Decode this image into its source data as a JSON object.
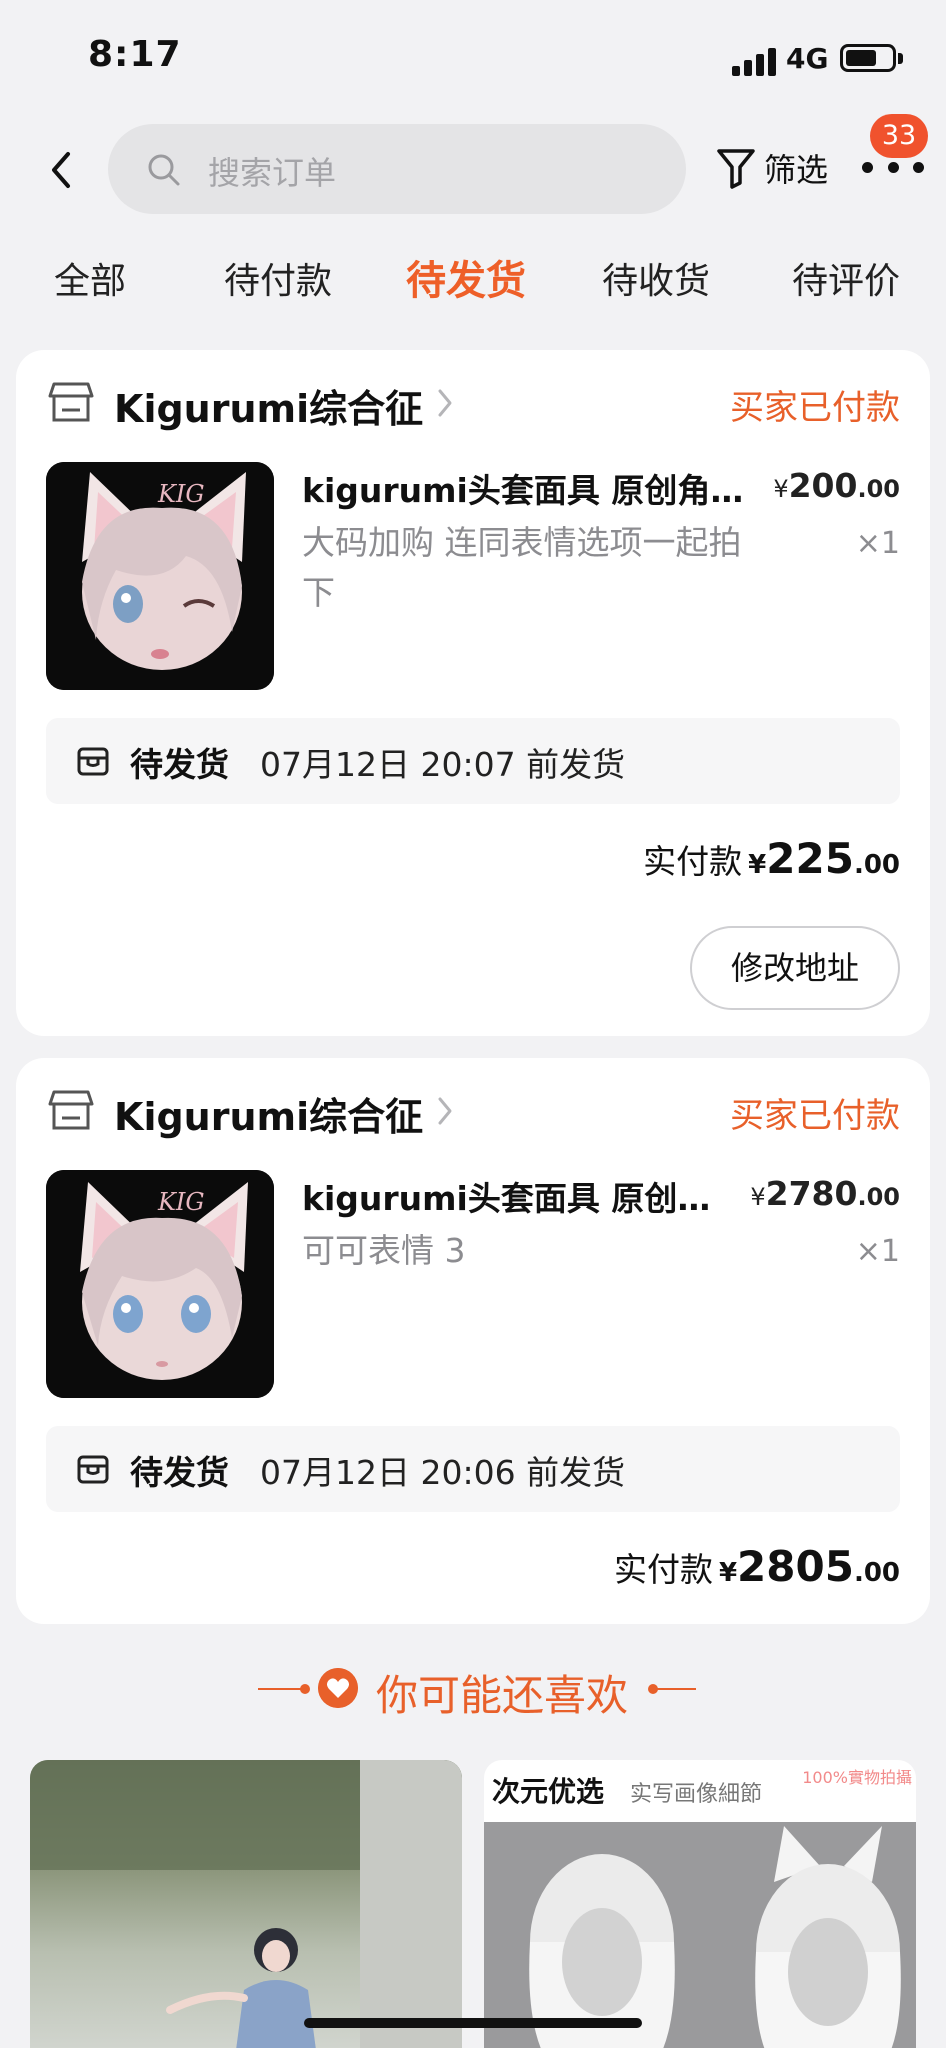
{
  "status_bar": {
    "time": "8:17",
    "network": "4G"
  },
  "search": {
    "placeholder": "搜索订单"
  },
  "header": {
    "filter_label": "筛选",
    "message_badge": "33"
  },
  "tabs": [
    {
      "label": "全部",
      "active": false
    },
    {
      "label": "待付款",
      "active": false
    },
    {
      "label": "待发货",
      "active": true
    },
    {
      "label": "待收货",
      "active": false
    },
    {
      "label": "待评价",
      "active": false
    }
  ],
  "orders": [
    {
      "store_name": "Kigurumi综合征",
      "status": "买家已付款",
      "product_title": "kigurumi头套面具 原创角…",
      "product_spec": "大码加购 连同表情选项一起拍下",
      "price_symbol": "¥",
      "price_int": "200",
      "price_dec": ".00",
      "quantity": "×1",
      "ship_label": "待发货",
      "ship_deadline": "07月12日 20:07 前发货",
      "total_label": "实付款",
      "total_symbol": "¥",
      "total_int": "225",
      "total_dec": ".00",
      "action_label": "修改地址"
    },
    {
      "store_name": "Kigurumi综合征",
      "status": "买家已付款",
      "product_title": "kigurumi头套面具 原创…",
      "product_spec": "可可表情 3",
      "price_symbol": "¥",
      "price_int": "2780",
      "price_dec": ".00",
      "quantity": "×1",
      "ship_label": "待发货",
      "ship_deadline": "07月12日 20:06 前发货",
      "total_label": "实付款",
      "total_symbol": "¥",
      "total_int": "2805",
      "total_dec": ".00"
    }
  ],
  "recommend": {
    "title": "你可能还喜欢",
    "right_card": {
      "brand": "次元优选",
      "tagline": "实写画像細節",
      "corner_text": "100%實物拍攝"
    }
  },
  "colors": {
    "accent": "#ee5f28",
    "badge": "#f0522d",
    "background": "#f2f2f4"
  }
}
